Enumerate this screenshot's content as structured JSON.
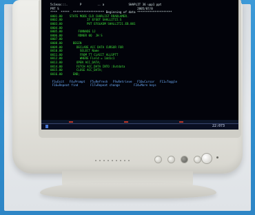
{
  "screen": {
    "lines": [
      {
        "text": "  5c1eaa:::.       P         .. a              SHAPLIT 36 upp1 ppt",
        "style": "white"
      },
      {
        "text": "  PRT S                                             2005/07/0",
        "style": "white"
      },
      {
        "text": "  ****  *****  ****************** Beginning of data ********************",
        "style": "white"
      },
      {
        "text": "  0001.00    STATE MODE CLR CHARLIST RRADLAMER.",
        "style": "green"
      },
      {
        "text": "  0002.00              IF EFOOT SHALLIT15.S",
        "style": "green"
      },
      {
        "text": "  0003.00              PUT EFOLKOM SHALLIT21.EB.001",
        "style": "green"
      },
      {
        "text": "  0004.00",
        "style": "green"
      },
      {
        "text": "  0005.00         FUNNADE 1J",
        "style": "green"
      },
      {
        "text": "  0006.00         RDNER 0Q  JH S",
        "style": "green"
      },
      {
        "text": "  0007.00",
        "style": "green"
      },
      {
        "text": "  0008.00      BEGIN",
        "style": "green"
      },
      {
        "text": "  0009.00        DECLARE ACC DATA CURSOR FOR",
        "style": "green"
      },
      {
        "text": "  0010.00          SELECT Name",
        "style": "green"
      },
      {
        "text": "  0011.00          FROM TT CLACCT ALLSPTT",
        "style": "green"
      },
      {
        "text": "  0012.00          WHERE Field = 1dd1c1",
        "style": "green"
      },
      {
        "text": "  0013.00        OPEN ACC_DATA;",
        "style": "green"
      },
      {
        "text": "  0014.00        FETCH ACC_DATA INTO :Outdata",
        "style": "green"
      },
      {
        "text": "  0015.00        CLOSE ACC_DATA;",
        "style": "green"
      },
      {
        "text": "  0016.00      END;",
        "style": "green"
      },
      {
        "text": "",
        "style": "green"
      },
      {
        "text": "   F3=Exit   F4=Prompt   F5=Refresh   F9=Retrieve   F10=Cursor   F11=Toggle",
        "style": "blue"
      },
      {
        "text": "   F16=Repeat find       F17=Repeat change        F24=More keys",
        "style": "blue"
      }
    ],
    "clock": "22:073"
  }
}
